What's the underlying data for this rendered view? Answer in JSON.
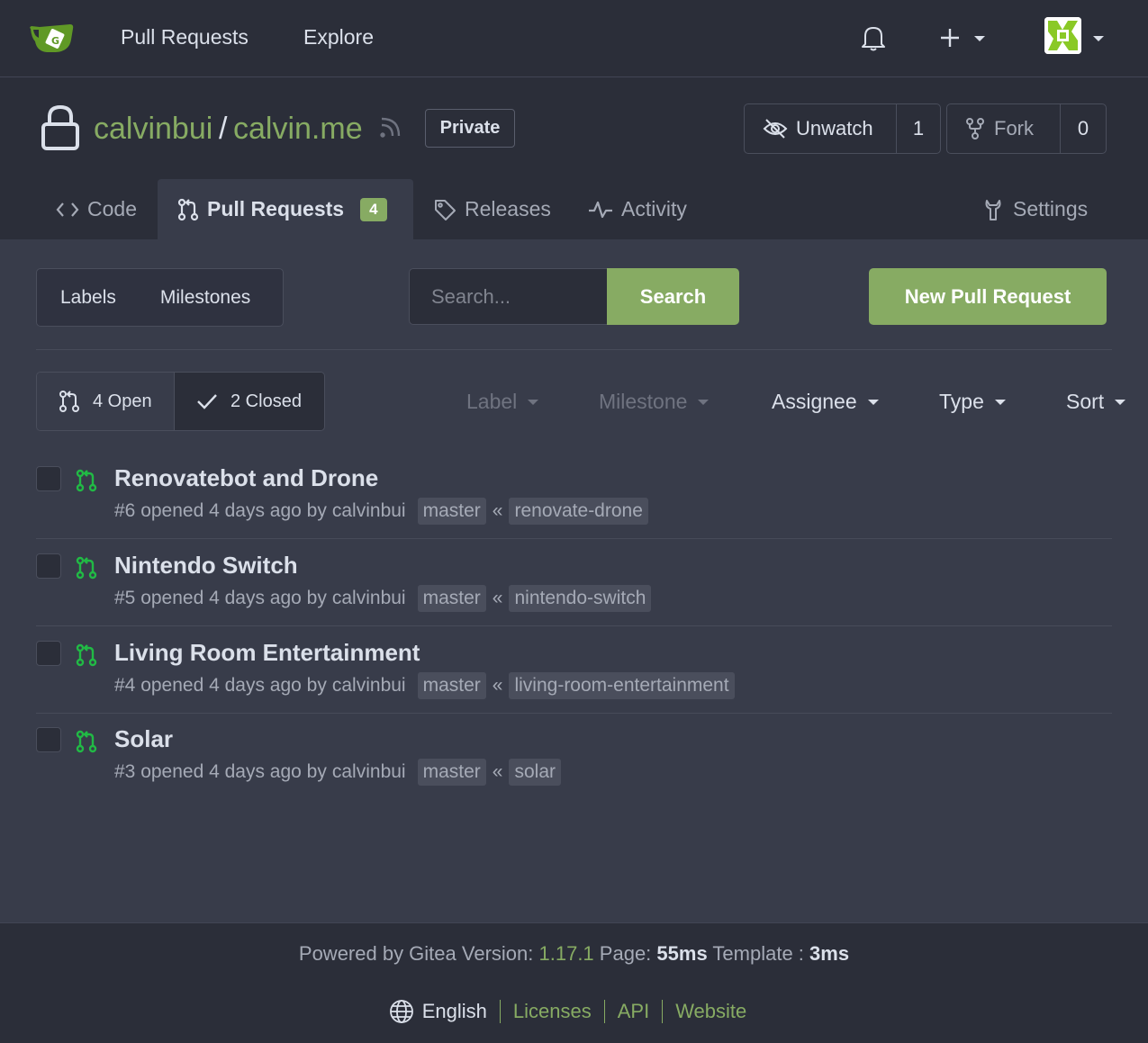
{
  "nav": {
    "pull_requests": "Pull Requests",
    "explore": "Explore"
  },
  "repo": {
    "owner": "calvinbui",
    "separator": "/",
    "name": "calvin.me",
    "visibility": "Private",
    "watch_label": "Unwatch",
    "watch_count": "1",
    "fork_label": "Fork",
    "fork_count": "0"
  },
  "tabs": {
    "code": "Code",
    "pull_requests": "Pull Requests",
    "pull_requests_count": "4",
    "releases": "Releases",
    "activity": "Activity",
    "settings": "Settings"
  },
  "toolbar": {
    "labels": "Labels",
    "milestones": "Milestones",
    "search_placeholder": "Search...",
    "search_button": "Search",
    "new_pull_request": "New Pull Request"
  },
  "state": {
    "open": "4 Open",
    "closed": "2 Closed"
  },
  "filters": {
    "label": "Label",
    "milestone": "Milestone",
    "assignee": "Assignee",
    "type": "Type",
    "sort": "Sort"
  },
  "pulls": [
    {
      "title": "Renovatebot and Drone",
      "meta": "#6 opened 4 days ago by",
      "author": "calvinbui",
      "base": "master",
      "separator": "«",
      "head": "renovate-drone"
    },
    {
      "title": "Nintendo Switch",
      "meta": "#5 opened 4 days ago by",
      "author": "calvinbui",
      "base": "master",
      "separator": "«",
      "head": "nintendo-switch"
    },
    {
      "title": "Living Room Entertainment",
      "meta": "#4 opened 4 days ago by",
      "author": "calvinbui",
      "base": "master",
      "separator": "«",
      "head": "living-room-entertainment"
    },
    {
      "title": "Solar",
      "meta": "#3 opened 4 days ago by",
      "author": "calvinbui",
      "base": "master",
      "separator": "«",
      "head": "solar"
    }
  ],
  "footer": {
    "powered_by": "Powered by Gitea Version:",
    "version": "1.17.1",
    "page_label": "Page:",
    "page_time": "55ms",
    "template_label": "Template :",
    "template_time": "3ms",
    "language": "English",
    "licenses": "Licenses",
    "api": "API",
    "website": "Website"
  },
  "colors": {
    "accent": "#87ab63",
    "pr_open_icon": "#21ba45",
    "background": "#383c4a",
    "header_background": "#2b2e39"
  }
}
